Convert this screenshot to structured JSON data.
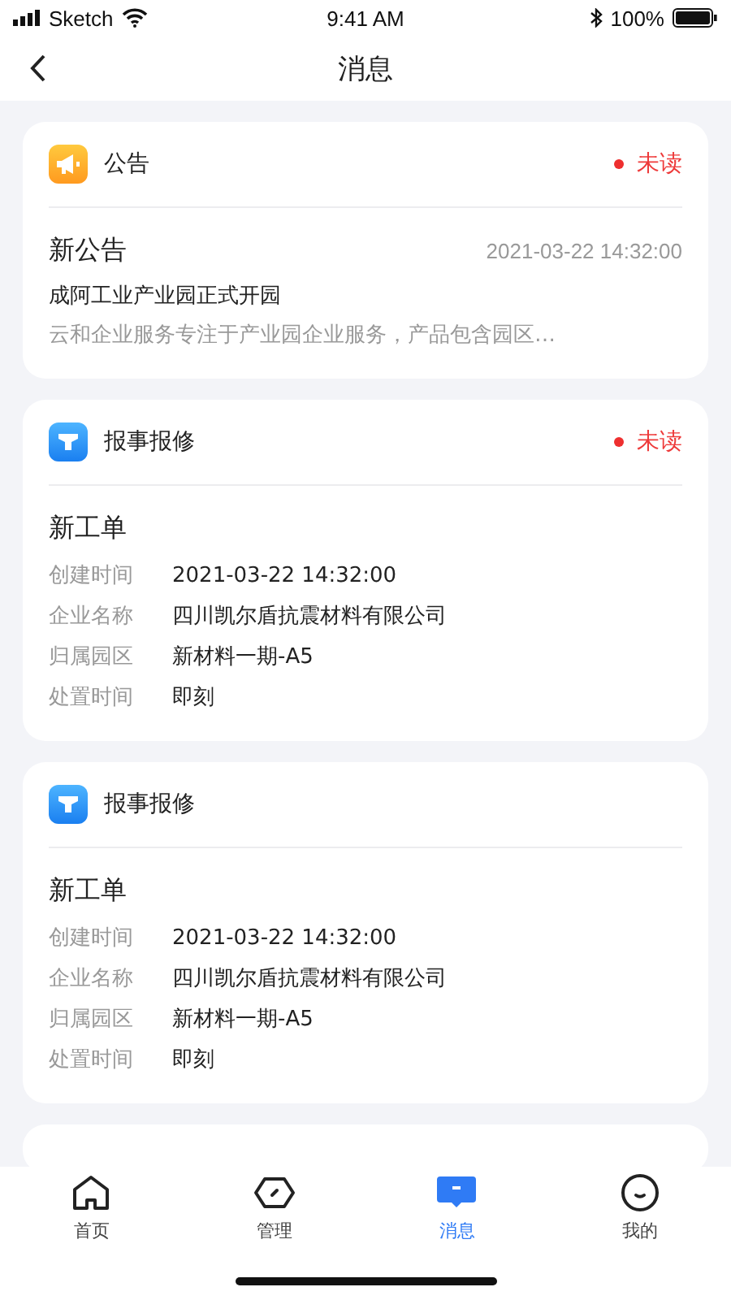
{
  "status_bar": {
    "carrier": "Sketch",
    "time": "9:41 AM",
    "battery": "100%"
  },
  "nav": {
    "title": "消息"
  },
  "messages": [
    {
      "kind": "notice",
      "category": "公告",
      "unread": true,
      "unread_label": "未读",
      "title": "新公告",
      "date": "2021-03-22 14:32:00",
      "headline": "成阿工业产业园正式开园",
      "excerpt": "云和企业服务专注于产业园企业服务，产品包含园区…"
    },
    {
      "kind": "order",
      "category": "报事报修",
      "unread": true,
      "unread_label": "未读",
      "title": "新工单",
      "fields": [
        {
          "label": "创建时间",
          "value": "2021-03-22 14:32:00"
        },
        {
          "label": "企业名称",
          "value": "四川凯尔盾抗震材料有限公司"
        },
        {
          "label": "归属园区",
          "value": "新材料一期-A5"
        },
        {
          "label": "处置时间",
          "value": "即刻"
        }
      ]
    },
    {
      "kind": "order",
      "category": "报事报修",
      "unread": false,
      "title": "新工单",
      "fields": [
        {
          "label": "创建时间",
          "value": "2021-03-22 14:32:00"
        },
        {
          "label": "企业名称",
          "value": "四川凯尔盾抗震材料有限公司"
        },
        {
          "label": "归属园区",
          "value": "新材料一期-A5"
        },
        {
          "label": "处置时间",
          "value": "即刻"
        }
      ]
    }
  ],
  "tabs": [
    {
      "kind": "home",
      "label": "首页",
      "selected": false
    },
    {
      "kind": "manage",
      "label": "管理",
      "selected": false
    },
    {
      "kind": "message",
      "label": "消息",
      "selected": true
    },
    {
      "kind": "me",
      "label": "我的",
      "selected": false
    }
  ]
}
